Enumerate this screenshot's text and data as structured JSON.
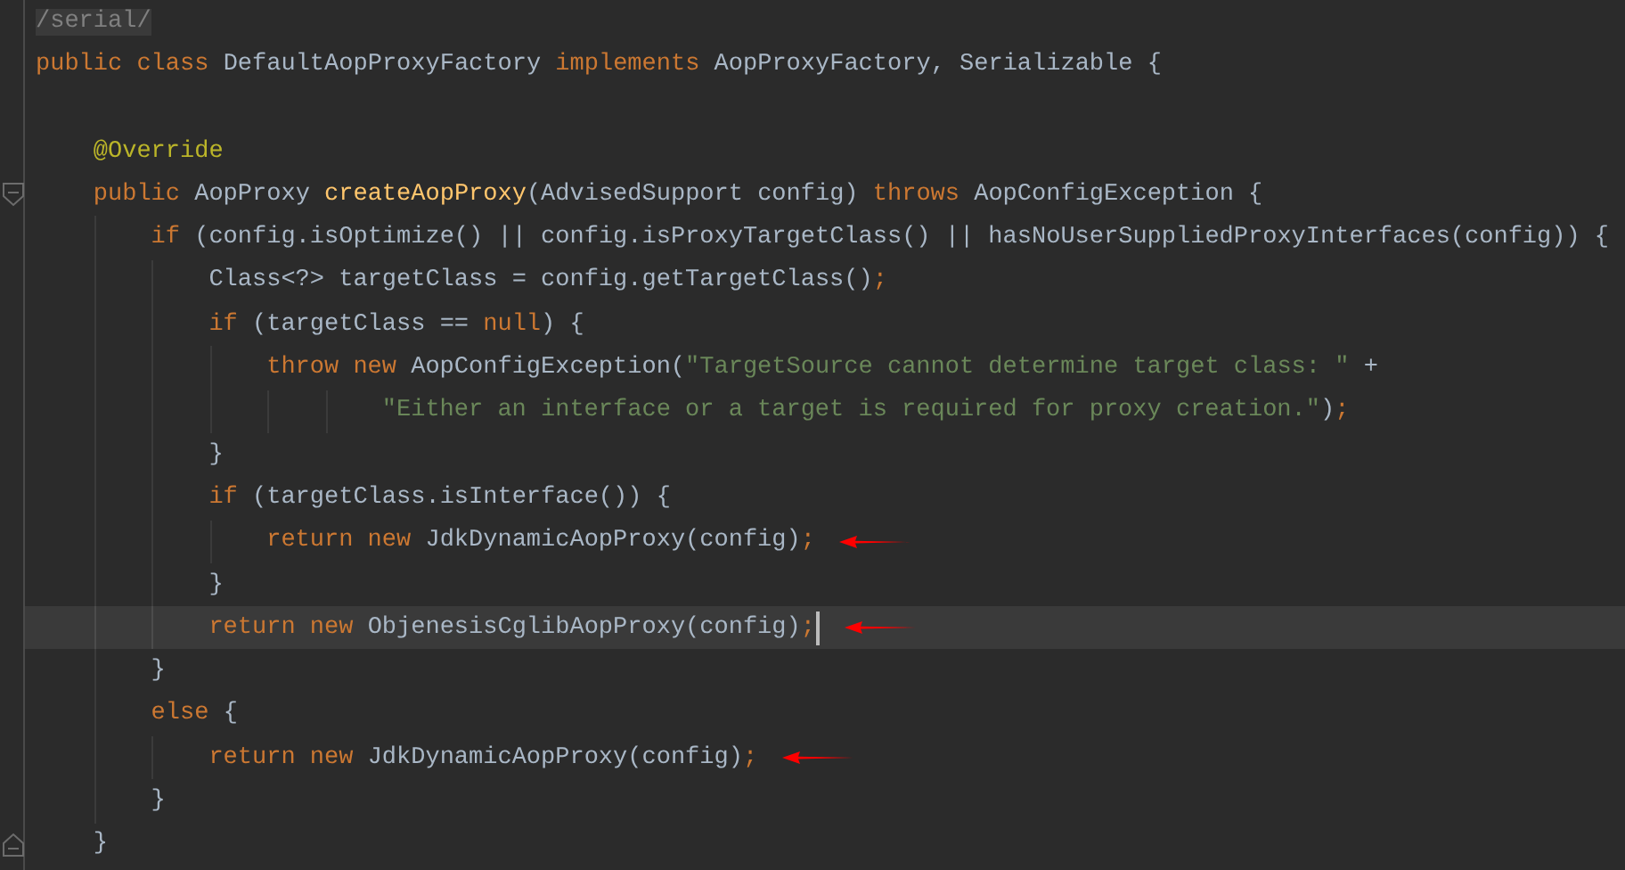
{
  "editor": {
    "lines": [
      {
        "tokens": [
          {
            "kind": "comment",
            "text": "/serial/"
          }
        ]
      },
      {
        "tokens": [
          {
            "kind": "keyword",
            "text": "public class "
          },
          {
            "kind": "plain",
            "text": "DefaultAopProxyFactory "
          },
          {
            "kind": "keyword",
            "text": "implements "
          },
          {
            "kind": "plain",
            "text": "AopProxyFactory, Serializable {"
          }
        ],
        "children": [
          {
            "blank_line_before": true,
            "tokens": [
              {
                "kind": "annotation",
                "text": "@Override"
              }
            ]
          },
          {
            "fold_start": true,
            "tokens": [
              {
                "kind": "keyword",
                "text": "public "
              },
              {
                "kind": "plain",
                "text": "AopProxy "
              },
              {
                "kind": "method",
                "text": "createAopProxy"
              },
              {
                "kind": "plain",
                "text": "(AdvisedSupport config) "
              },
              {
                "kind": "keyword",
                "text": "throws "
              },
              {
                "kind": "plain",
                "text": "AopConfigException {"
              }
            ],
            "children": [
              {
                "tokens": [
                  {
                    "kind": "keyword",
                    "text": "if "
                  },
                  {
                    "kind": "plain",
                    "text": "(config.isOptimize() || config.isProxyTargetClass() || hasNoUserSuppliedProxyInterfaces(config)) {"
                  }
                ],
                "children": [
                  {
                    "tokens": [
                      {
                        "kind": "plain",
                        "text": "Class<?> targetClass = config.getTargetClass()"
                      },
                      {
                        "kind": "keyword",
                        "text": ";"
                      }
                    ]
                  },
                  {
                    "tokens": [
                      {
                        "kind": "keyword",
                        "text": "if "
                      },
                      {
                        "kind": "plain",
                        "text": "(targetClass == "
                      },
                      {
                        "kind": "keyword",
                        "text": "null"
                      },
                      {
                        "kind": "plain",
                        "text": ") {"
                      }
                    ],
                    "children": [
                      {
                        "tokens": [
                          {
                            "kind": "keyword",
                            "text": "throw new "
                          },
                          {
                            "kind": "plain",
                            "text": "AopConfigException("
                          },
                          {
                            "kind": "string",
                            "text": "\"TargetSource cannot determine target class: \""
                          },
                          {
                            "kind": "plain",
                            "text": " +"
                          }
                        ],
                        "children": [
                          {
                            "kind": "continuation",
                            "tokens": [
                              {
                                "kind": "string",
                                "text": "\"Either an interface or a target is required for proxy creation.\""
                              },
                              {
                                "kind": "plain",
                                "text": ")"
                              },
                              {
                                "kind": "keyword",
                                "text": ";"
                              }
                            ]
                          }
                        ]
                      }
                    ]
                  },
                  {
                    "tokens": [
                      {
                        "kind": "plain",
                        "text": "}"
                      }
                    ]
                  },
                  {
                    "tokens": [
                      {
                        "kind": "keyword",
                        "text": "if "
                      },
                      {
                        "kind": "plain",
                        "text": "(targetClass.isInterface()) {"
                      }
                    ],
                    "children": [
                      {
                        "arrow": true,
                        "tokens": [
                          {
                            "kind": "keyword",
                            "text": "return new "
                          },
                          {
                            "kind": "plain",
                            "text": "JdkDynamicAopProxy(config)"
                          },
                          {
                            "kind": "keyword",
                            "text": ";"
                          }
                        ]
                      }
                    ]
                  },
                  {
                    "tokens": [
                      {
                        "kind": "plain",
                        "text": "}"
                      }
                    ]
                  },
                  {
                    "current": true,
                    "caret": true,
                    "arrow": true,
                    "tokens": [
                      {
                        "kind": "keyword",
                        "text": "return new "
                      },
                      {
                        "kind": "plain",
                        "text": "ObjenesisCglibAopProxy(config)"
                      },
                      {
                        "kind": "keyword",
                        "text": ";"
                      }
                    ]
                  }
                ]
              },
              {
                "tokens": [
                  {
                    "kind": "plain",
                    "text": "}"
                  }
                ]
              },
              {
                "tokens": [
                  {
                    "kind": "keyword",
                    "text": "else "
                  },
                  {
                    "kind": "plain",
                    "text": "{"
                  }
                ],
                "children": [
                  {
                    "arrow": true,
                    "tokens": [
                      {
                        "kind": "keyword",
                        "text": "return new "
                      },
                      {
                        "kind": "plain",
                        "text": "JdkDynamicAopProxy(config)"
                      },
                      {
                        "kind": "keyword",
                        "text": ";"
                      }
                    ]
                  }
                ]
              },
              {
                "tokens": [
                  {
                    "kind": "plain",
                    "text": "}"
                  }
                ]
              }
            ]
          },
          {
            "fold_end": true,
            "tokens": [
              {
                "kind": "plain",
                "text": "}"
              }
            ]
          }
        ]
      }
    ]
  }
}
